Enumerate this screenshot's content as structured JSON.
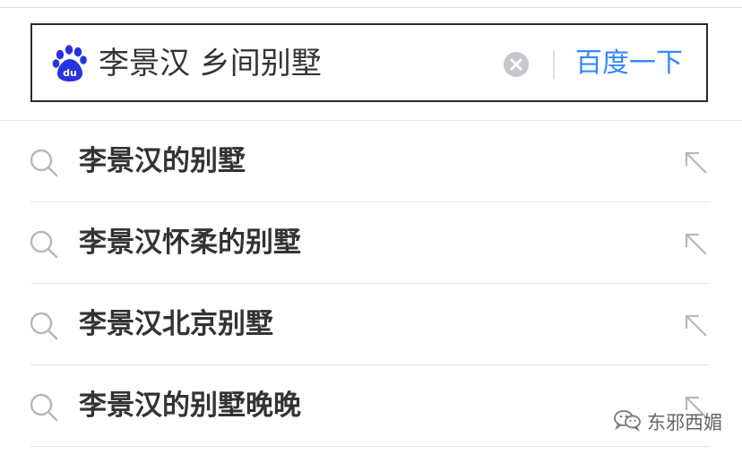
{
  "search": {
    "query": "李景汉 乡间别墅",
    "submit_label": "百度一下"
  },
  "suggestions": [
    {
      "text": "李景汉的别墅"
    },
    {
      "text": "李景汉怀柔的别墅"
    },
    {
      "text": "李景汉北京别墅"
    },
    {
      "text": "李景汉的别墅晚晚"
    }
  ],
  "watermark": {
    "text": "东邪西媚"
  },
  "colors": {
    "accent": "#3388ff",
    "logo": "#2932e1",
    "text": "#333333",
    "icon_gray": "#b8b8b8"
  },
  "icons": {
    "logo": "baidu-paw-icon",
    "clear": "clear-icon",
    "suggestion": "search-icon",
    "fill": "arrow-up-left-icon",
    "watermark": "wechat-icon"
  }
}
